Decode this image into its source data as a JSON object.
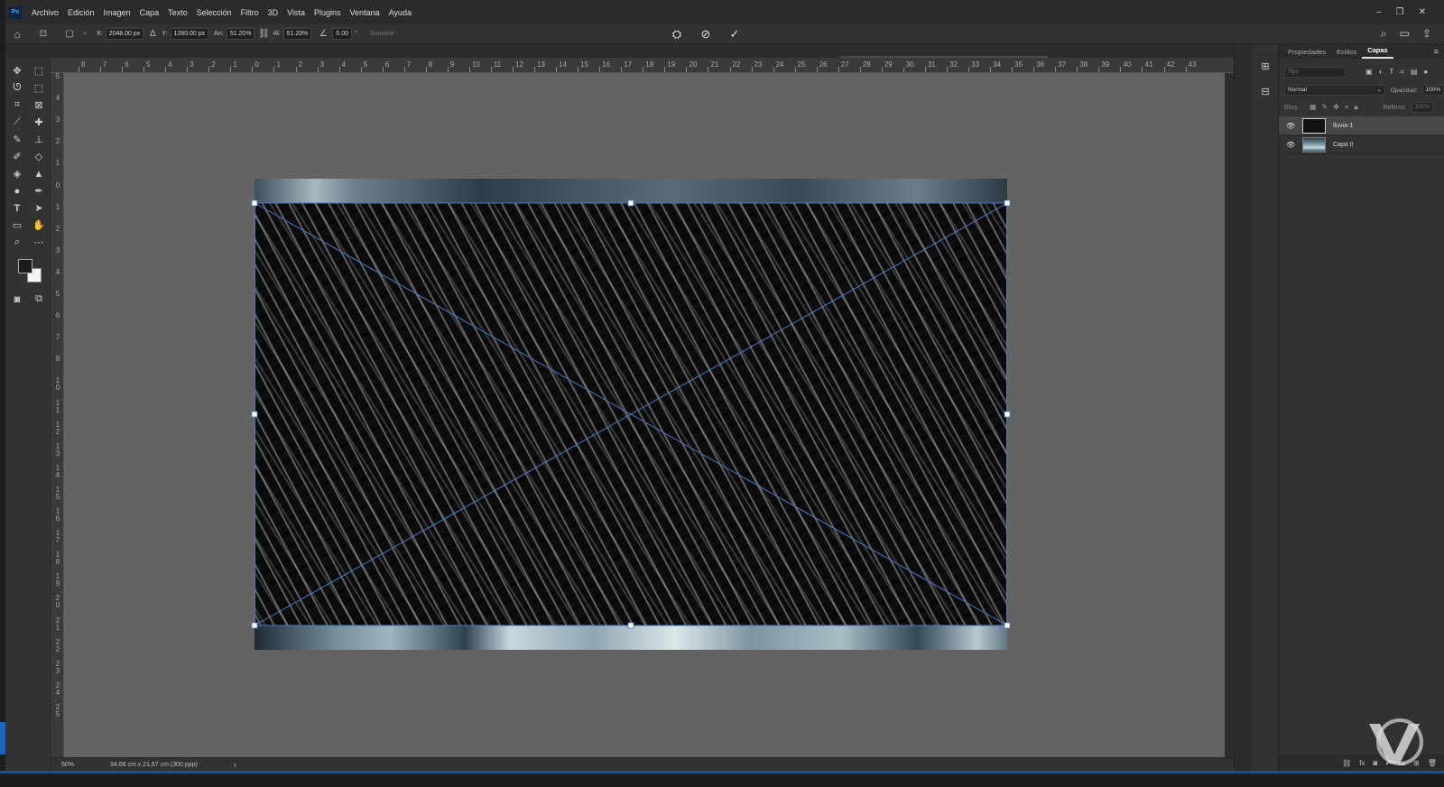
{
  "app": {
    "logo": "Ps"
  },
  "menu": [
    "Archivo",
    "Edición",
    "Imagen",
    "Capa",
    "Texto",
    "Selección",
    "Filtro",
    "3D",
    "Vista",
    "Plugins",
    "Ventana",
    "Ayuda"
  ],
  "window_controls": [
    "minimize-icon",
    "restore-icon",
    "close-icon"
  ],
  "options": {
    "x_label": "X:",
    "x_value": "2048.00 px",
    "y_label": "Y:",
    "y_value": "1280.00 px",
    "w_label": "An:",
    "w_value": "51.20%",
    "h_label": "Al:",
    "h_value": "51.20%",
    "angle_value": "0.00",
    "angle_unit": "°",
    "interp_label": "Suavizar",
    "cancel_icon": "cancel-transform-icon",
    "commit_icon": "commit-transform-icon"
  },
  "ruler_top": [
    "8",
    "7",
    "6",
    "5",
    "4",
    "3",
    "2",
    "1",
    "0",
    "1",
    "2",
    "3",
    "4",
    "5",
    "6",
    "7",
    "8",
    "9",
    "10",
    "11",
    "12",
    "13",
    "14",
    "15",
    "16",
    "17",
    "18",
    "19",
    "20",
    "21",
    "22",
    "23",
    "24",
    "25",
    "26",
    "27",
    "28",
    "29",
    "30",
    "31",
    "32",
    "33",
    "34",
    "35",
    "36",
    "37",
    "38",
    "39",
    "40",
    "41",
    "42",
    "43"
  ],
  "ruler_left": [
    "5",
    "4",
    "3",
    "2",
    "1",
    "0",
    "1",
    "2",
    "3",
    "4",
    "5",
    "6",
    "7",
    "8",
    "1 0",
    "1 1",
    "1 2",
    "1 3",
    "1 4",
    "1 5",
    "1 6",
    "1 7",
    "1 8",
    "1 9",
    "2 0",
    "2 1",
    "2 2",
    "2 3",
    "2 4",
    "2 5"
  ],
  "status": {
    "zoom": "50%",
    "doc_info": "34,68 cm x 21,67 cm (300 ppp)",
    "arrow": "›"
  },
  "panel": {
    "tabs": [
      "Propiedades",
      "Estilos",
      "Capas"
    ],
    "active_tab": "Capas",
    "filter_placeholder": "Tipo",
    "blend_mode": "Normal",
    "opacity_label": "Opacidad:",
    "opacity_value": "100%",
    "lock_label": "Bloq.:",
    "fill_label": "Relleno:",
    "fill_value": "100%"
  },
  "layers": [
    {
      "name": "lluvia-1",
      "visible": true,
      "selected": true
    },
    {
      "name": "Capa 0",
      "visible": true,
      "selected": false
    }
  ],
  "colors": {
    "accent": "#31a8ff",
    "transform_box": "#4a78c8",
    "canvas_bg": "#636363"
  }
}
